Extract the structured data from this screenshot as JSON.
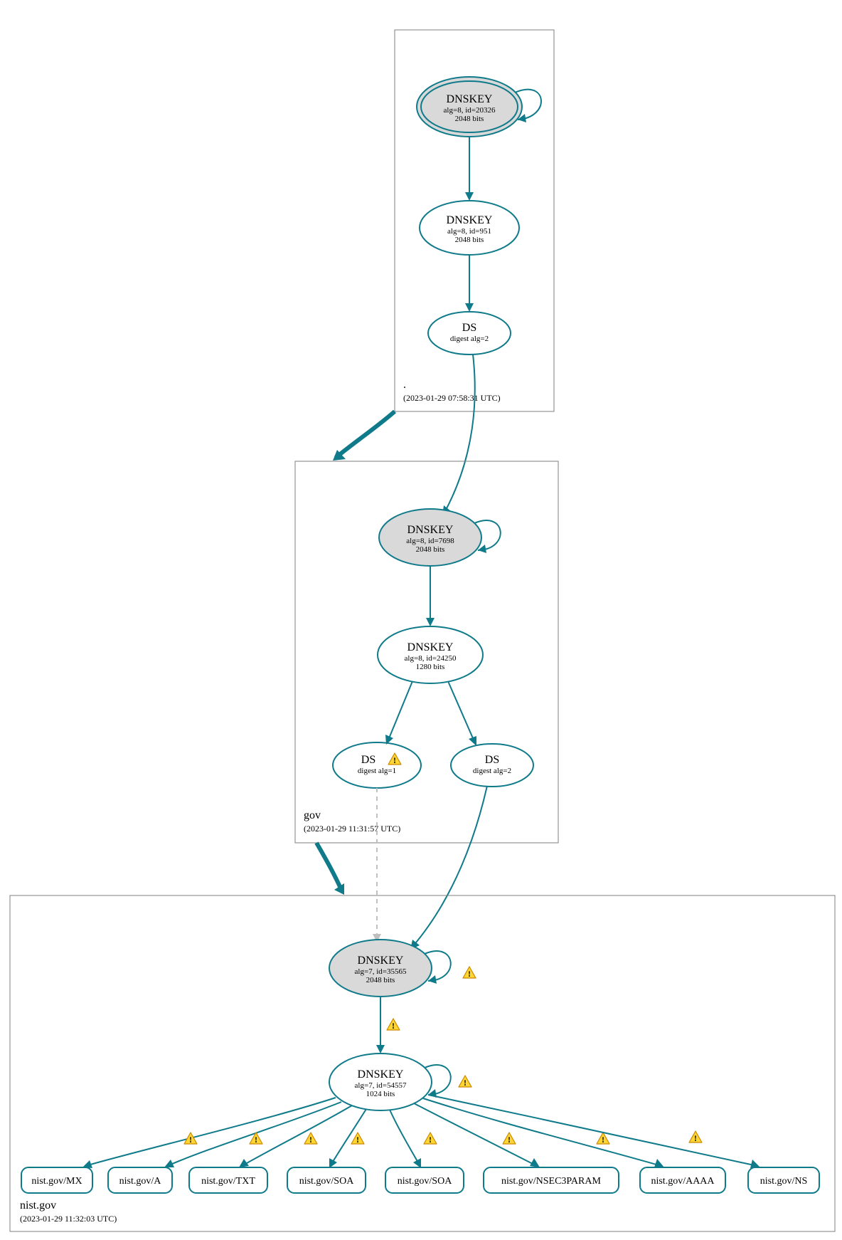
{
  "zones": {
    "root": {
      "name": ".",
      "timestamp": "(2023-01-29 07:58:31 UTC)"
    },
    "gov": {
      "name": "gov",
      "timestamp": "(2023-01-29 11:31:57 UTC)"
    },
    "nist": {
      "name": "nist.gov",
      "timestamp": "(2023-01-29 11:32:03 UTC)"
    }
  },
  "nodes": {
    "root_ksk": {
      "title": "DNSKEY",
      "alg": "alg=8, id=20326",
      "bits": "2048 bits"
    },
    "root_zsk": {
      "title": "DNSKEY",
      "alg": "alg=8, id=951",
      "bits": "2048 bits"
    },
    "root_ds": {
      "title": "DS",
      "digest": "digest alg=2"
    },
    "gov_ksk": {
      "title": "DNSKEY",
      "alg": "alg=8, id=7698",
      "bits": "2048 bits"
    },
    "gov_zsk": {
      "title": "DNSKEY",
      "alg": "alg=8, id=24250",
      "bits": "1280 bits"
    },
    "gov_ds1": {
      "title": "DS",
      "digest": "digest alg=1"
    },
    "gov_ds2": {
      "title": "DS",
      "digest": "digest alg=2"
    },
    "nist_ksk": {
      "title": "DNSKEY",
      "alg": "alg=7, id=35565",
      "bits": "2048 bits"
    },
    "nist_zsk": {
      "title": "DNSKEY",
      "alg": "alg=7, id=54557",
      "bits": "1024 bits"
    }
  },
  "records": {
    "mx": "nist.gov/MX",
    "a": "nist.gov/A",
    "txt": "nist.gov/TXT",
    "soa1": "nist.gov/SOA",
    "soa2": "nist.gov/SOA",
    "n3p": "nist.gov/NSEC3PARAM",
    "aaaa": "nist.gov/AAAA",
    "ns": "nist.gov/NS"
  },
  "colors": {
    "stroke": "#0f7a8a",
    "box": "#7f7f7f",
    "kskFill": "#d9d9d9",
    "warnFill": "#ffd633",
    "warnStroke": "#cc8800",
    "dash": "#bfbfbf"
  }
}
